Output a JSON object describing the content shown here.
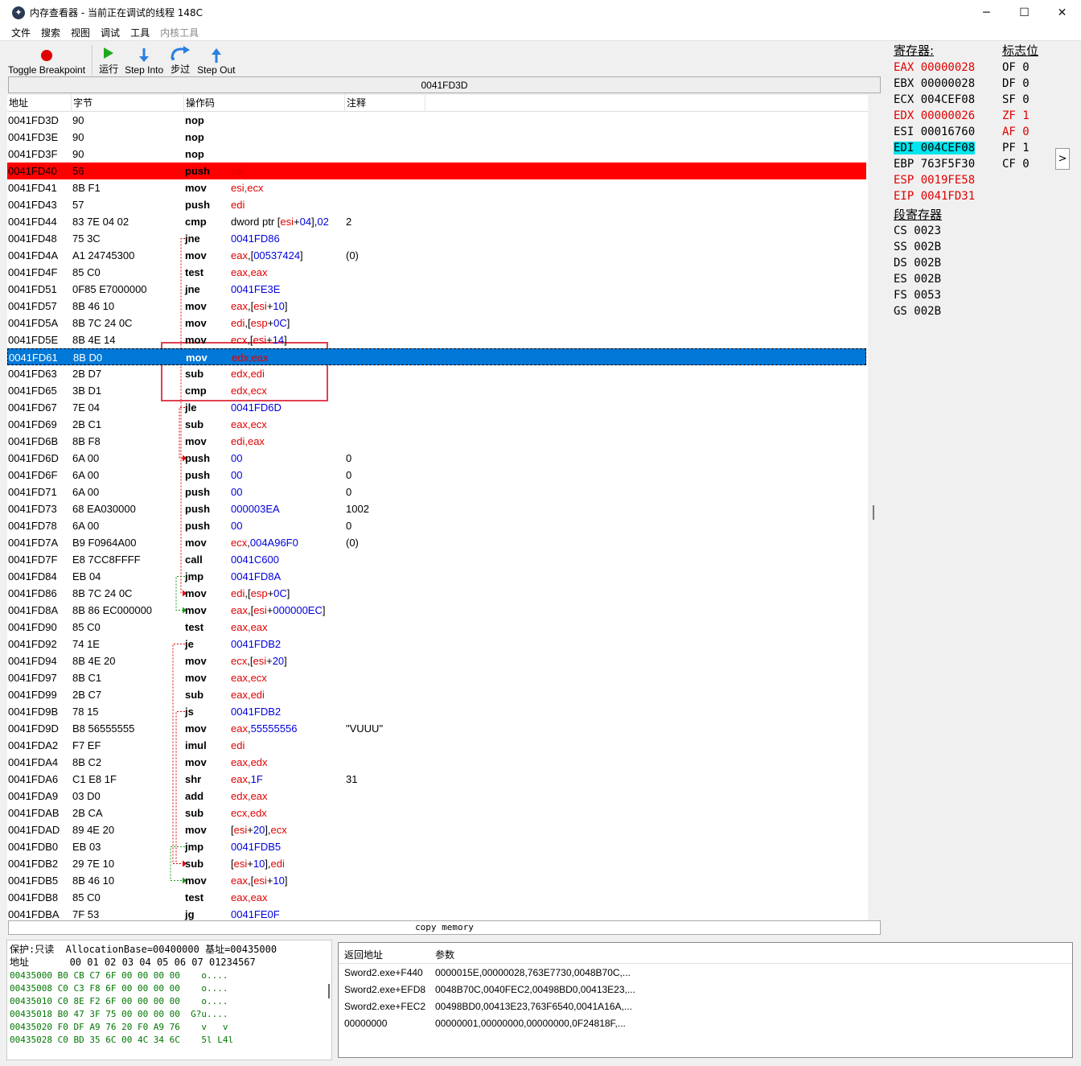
{
  "window": {
    "title": "内存查看器 - 当前正在调试的线程 148C",
    "minimize": "─",
    "maximize": "☐",
    "close": "✕"
  },
  "menu": [
    "文件",
    "搜索",
    "视图",
    "调试",
    "工具",
    "内核工具"
  ],
  "toolbar": {
    "toggle_breakpoint": "Toggle Breakpoint",
    "run": "运行",
    "step_into": "Step Into",
    "step_over": "步过",
    "step_out": "Step Out"
  },
  "address_bar": "0041FD3D",
  "columns": {
    "address": "地址",
    "bytes": "字节",
    "opcode": "操作码",
    "comment": "注释"
  },
  "rows": [
    {
      "addr": "0041FD3D",
      "bytes": "90",
      "op": "nop",
      "args": [],
      "cmt": ""
    },
    {
      "addr": "0041FD3E",
      "bytes": "90",
      "op": "nop",
      "args": [],
      "cmt": ""
    },
    {
      "addr": "0041FD3F",
      "bytes": "90",
      "op": "nop",
      "args": [],
      "cmt": ""
    },
    {
      "addr": "0041FD40",
      "bytes": "56",
      "op": "push",
      "args": [
        {
          "t": "esi",
          "c": "reg"
        }
      ],
      "cmt": "",
      "state": "bp"
    },
    {
      "addr": "0041FD41",
      "bytes": "8B F1",
      "op": "mov",
      "args": [
        {
          "t": "esi,ecx",
          "c": "reg"
        }
      ],
      "cmt": ""
    },
    {
      "addr": "0041FD43",
      "bytes": "57",
      "op": "push",
      "args": [
        {
          "t": "edi",
          "c": "reg"
        }
      ],
      "cmt": ""
    },
    {
      "addr": "0041FD44",
      "bytes": "83 7E 04 02",
      "op": "cmp",
      "args": [
        {
          "t": "dword ptr [",
          "c": "blk"
        },
        {
          "t": "esi",
          "c": "reg"
        },
        {
          "t": "+",
          "c": "blk"
        },
        {
          "t": "04",
          "c": "num"
        },
        {
          "t": "],",
          "c": "blk"
        },
        {
          "t": "02",
          "c": "num"
        }
      ],
      "cmt": "2"
    },
    {
      "addr": "0041FD48",
      "bytes": "75 3C",
      "op": "jne",
      "args": [
        {
          "t": "0041FD86",
          "c": "num"
        }
      ],
      "cmt": ""
    },
    {
      "addr": "0041FD4A",
      "bytes": "A1 24745300",
      "op": "mov",
      "args": [
        {
          "t": "eax",
          "c": "reg"
        },
        {
          "t": ",[",
          "c": "blk"
        },
        {
          "t": "00537424",
          "c": "num"
        },
        {
          "t": "]",
          "c": "blk"
        }
      ],
      "cmt": "(0)"
    },
    {
      "addr": "0041FD4F",
      "bytes": "85 C0",
      "op": "test",
      "args": [
        {
          "t": "eax,eax",
          "c": "reg"
        }
      ],
      "cmt": ""
    },
    {
      "addr": "0041FD51",
      "bytes": "0F85 E7000000",
      "op": "jne",
      "args": [
        {
          "t": "0041FE3E",
          "c": "num"
        }
      ],
      "cmt": ""
    },
    {
      "addr": "0041FD57",
      "bytes": "8B 46 10",
      "op": "mov",
      "args": [
        {
          "t": "eax",
          "c": "reg"
        },
        {
          "t": ",[",
          "c": "blk"
        },
        {
          "t": "esi",
          "c": "reg"
        },
        {
          "t": "+",
          "c": "blk"
        },
        {
          "t": "10",
          "c": "num"
        },
        {
          "t": "]",
          "c": "blk"
        }
      ],
      "cmt": ""
    },
    {
      "addr": "0041FD5A",
      "bytes": "8B 7C 24 0C",
      "op": "mov",
      "args": [
        {
          "t": "edi",
          "c": "reg"
        },
        {
          "t": ",[",
          "c": "blk"
        },
        {
          "t": "esp",
          "c": "reg"
        },
        {
          "t": "+",
          "c": "blk"
        },
        {
          "t": "0C",
          "c": "num"
        },
        {
          "t": "]",
          "c": "blk"
        }
      ],
      "cmt": ""
    },
    {
      "addr": "0041FD5E",
      "bytes": "8B 4E 14",
      "op": "mov",
      "args": [
        {
          "t": "ecx",
          "c": "reg"
        },
        {
          "t": ",[",
          "c": "blk"
        },
        {
          "t": "esi",
          "c": "reg"
        },
        {
          "t": "+",
          "c": "blk"
        },
        {
          "t": "14",
          "c": "num"
        },
        {
          "t": "]",
          "c": "blk"
        }
      ],
      "cmt": ""
    },
    {
      "addr": "0041FD61",
      "bytes": "8B D0",
      "op": "mov",
      "args": [
        {
          "t": "edx,eax",
          "c": "reg"
        }
      ],
      "cmt": "",
      "state": "cur"
    },
    {
      "addr": "0041FD63",
      "bytes": "2B D7",
      "op": "sub",
      "args": [
        {
          "t": "edx,edi",
          "c": "reg"
        }
      ],
      "cmt": ""
    },
    {
      "addr": "0041FD65",
      "bytes": "3B D1",
      "op": "cmp",
      "args": [
        {
          "t": "edx,ecx",
          "c": "reg"
        }
      ],
      "cmt": ""
    },
    {
      "addr": "0041FD67",
      "bytes": "7E 04",
      "op": "jle",
      "args": [
        {
          "t": "0041FD6D",
          "c": "num"
        }
      ],
      "cmt": ""
    },
    {
      "addr": "0041FD69",
      "bytes": "2B C1",
      "op": "sub",
      "args": [
        {
          "t": "eax,ecx",
          "c": "reg"
        }
      ],
      "cmt": ""
    },
    {
      "addr": "0041FD6B",
      "bytes": "8B F8",
      "op": "mov",
      "args": [
        {
          "t": "edi,eax",
          "c": "reg"
        }
      ],
      "cmt": ""
    },
    {
      "addr": "0041FD6D",
      "bytes": "6A 00",
      "op": "push",
      "args": [
        {
          "t": "00",
          "c": "num"
        }
      ],
      "cmt": "0"
    },
    {
      "addr": "0041FD6F",
      "bytes": "6A 00",
      "op": "push",
      "args": [
        {
          "t": "00",
          "c": "num"
        }
      ],
      "cmt": "0"
    },
    {
      "addr": "0041FD71",
      "bytes": "6A 00",
      "op": "push",
      "args": [
        {
          "t": "00",
          "c": "num"
        }
      ],
      "cmt": "0"
    },
    {
      "addr": "0041FD73",
      "bytes": "68 EA030000",
      "op": "push",
      "args": [
        {
          "t": "000003EA",
          "c": "num"
        }
      ],
      "cmt": "1002"
    },
    {
      "addr": "0041FD78",
      "bytes": "6A 00",
      "op": "push",
      "args": [
        {
          "t": "00",
          "c": "num"
        }
      ],
      "cmt": "0"
    },
    {
      "addr": "0041FD7A",
      "bytes": "B9 F0964A00",
      "op": "mov",
      "args": [
        {
          "t": "ecx",
          "c": "reg"
        },
        {
          "t": ",",
          "c": "blk"
        },
        {
          "t": "004A96F0",
          "c": "num"
        }
      ],
      "cmt": "(0)"
    },
    {
      "addr": "0041FD7F",
      "bytes": "E8 7CC8FFFF",
      "op": "call",
      "args": [
        {
          "t": "0041C600",
          "c": "num"
        }
      ],
      "cmt": ""
    },
    {
      "addr": "0041FD84",
      "bytes": "EB 04",
      "op": "jmp",
      "args": [
        {
          "t": "0041FD8A",
          "c": "num"
        }
      ],
      "cmt": ""
    },
    {
      "addr": "0041FD86",
      "bytes": "8B 7C 24 0C",
      "op": "mov",
      "args": [
        {
          "t": "edi",
          "c": "reg"
        },
        {
          "t": ",[",
          "c": "blk"
        },
        {
          "t": "esp",
          "c": "reg"
        },
        {
          "t": "+",
          "c": "blk"
        },
        {
          "t": "0C",
          "c": "num"
        },
        {
          "t": "]",
          "c": "blk"
        }
      ],
      "cmt": ""
    },
    {
      "addr": "0041FD8A",
      "bytes": "8B 86 EC000000",
      "op": "mov",
      "args": [
        {
          "t": "eax",
          "c": "reg"
        },
        {
          "t": ",[",
          "c": "blk"
        },
        {
          "t": "esi",
          "c": "reg"
        },
        {
          "t": "+",
          "c": "blk"
        },
        {
          "t": "000000EC",
          "c": "num"
        },
        {
          "t": "]",
          "c": "blk"
        }
      ],
      "cmt": ""
    },
    {
      "addr": "0041FD90",
      "bytes": "85 C0",
      "op": "test",
      "args": [
        {
          "t": "eax,eax",
          "c": "reg"
        }
      ],
      "cmt": ""
    },
    {
      "addr": "0041FD92",
      "bytes": "74 1E",
      "op": "je",
      "args": [
        {
          "t": "0041FDB2",
          "c": "num"
        }
      ],
      "cmt": ""
    },
    {
      "addr": "0041FD94",
      "bytes": "8B 4E 20",
      "op": "mov",
      "args": [
        {
          "t": "ecx",
          "c": "reg"
        },
        {
          "t": ",[",
          "c": "blk"
        },
        {
          "t": "esi",
          "c": "reg"
        },
        {
          "t": "+",
          "c": "blk"
        },
        {
          "t": "20",
          "c": "num"
        },
        {
          "t": "]",
          "c": "blk"
        }
      ],
      "cmt": ""
    },
    {
      "addr": "0041FD97",
      "bytes": "8B C1",
      "op": "mov",
      "args": [
        {
          "t": "eax,ecx",
          "c": "reg"
        }
      ],
      "cmt": ""
    },
    {
      "addr": "0041FD99",
      "bytes": "2B C7",
      "op": "sub",
      "args": [
        {
          "t": "eax,edi",
          "c": "reg"
        }
      ],
      "cmt": ""
    },
    {
      "addr": "0041FD9B",
      "bytes": "78 15",
      "op": "js",
      "args": [
        {
          "t": "0041FDB2",
          "c": "num"
        }
      ],
      "cmt": ""
    },
    {
      "addr": "0041FD9D",
      "bytes": "B8 56555555",
      "op": "mov",
      "args": [
        {
          "t": "eax",
          "c": "reg"
        },
        {
          "t": ",",
          "c": "blk"
        },
        {
          "t": "55555556",
          "c": "num"
        }
      ],
      "cmt": "\"VUUU\""
    },
    {
      "addr": "0041FDA2",
      "bytes": "F7 EF",
      "op": "imul",
      "args": [
        {
          "t": "edi",
          "c": "reg"
        }
      ],
      "cmt": ""
    },
    {
      "addr": "0041FDA4",
      "bytes": "8B C2",
      "op": "mov",
      "args": [
        {
          "t": "eax,edx",
          "c": "reg"
        }
      ],
      "cmt": ""
    },
    {
      "addr": "0041FDA6",
      "bytes": "C1 E8 1F",
      "op": "shr",
      "args": [
        {
          "t": "eax",
          "c": "reg"
        },
        {
          "t": ",",
          "c": "blk"
        },
        {
          "t": "1F",
          "c": "num"
        }
      ],
      "cmt": "31"
    },
    {
      "addr": "0041FDA9",
      "bytes": "03 D0",
      "op": "add",
      "args": [
        {
          "t": "edx,eax",
          "c": "reg"
        }
      ],
      "cmt": ""
    },
    {
      "addr": "0041FDAB",
      "bytes": "2B CA",
      "op": "sub",
      "args": [
        {
          "t": "ecx,edx",
          "c": "reg"
        }
      ],
      "cmt": ""
    },
    {
      "addr": "0041FDAD",
      "bytes": "89 4E 20",
      "op": "mov",
      "args": [
        {
          "t": "[",
          "c": "blk"
        },
        {
          "t": "esi",
          "c": "reg"
        },
        {
          "t": "+",
          "c": "blk"
        },
        {
          "t": "20",
          "c": "num"
        },
        {
          "t": "],",
          "c": "blk"
        },
        {
          "t": "ecx",
          "c": "reg"
        }
      ],
      "cmt": ""
    },
    {
      "addr": "0041FDB0",
      "bytes": "EB 03",
      "op": "jmp",
      "args": [
        {
          "t": "0041FDB5",
          "c": "num"
        }
      ],
      "cmt": ""
    },
    {
      "addr": "0041FDB2",
      "bytes": "29 7E 10",
      "op": "sub",
      "args": [
        {
          "t": "[",
          "c": "blk"
        },
        {
          "t": "esi",
          "c": "reg"
        },
        {
          "t": "+",
          "c": "blk"
        },
        {
          "t": "10",
          "c": "num"
        },
        {
          "t": "],",
          "c": "blk"
        },
        {
          "t": "edi",
          "c": "reg"
        }
      ],
      "cmt": ""
    },
    {
      "addr": "0041FDB5",
      "bytes": "8B 46 10",
      "op": "mov",
      "args": [
        {
          "t": "eax",
          "c": "reg"
        },
        {
          "t": ",[",
          "c": "blk"
        },
        {
          "t": "esi",
          "c": "reg"
        },
        {
          "t": "+",
          "c": "blk"
        },
        {
          "t": "10",
          "c": "num"
        },
        {
          "t": "]",
          "c": "blk"
        }
      ],
      "cmt": ""
    },
    {
      "addr": "0041FDB8",
      "bytes": "85 C0",
      "op": "test",
      "args": [
        {
          "t": "eax,eax",
          "c": "reg"
        }
      ],
      "cmt": ""
    },
    {
      "addr": "0041FDBA",
      "bytes": "7F 53",
      "op": "jg",
      "args": [
        {
          "t": "0041FE0F",
          "c": "num"
        }
      ],
      "cmt": ""
    }
  ],
  "copy_memory": "copy memory",
  "registers": {
    "title": "寄存器:",
    "flags_title": "标志位",
    "segments_title": "段寄存器",
    "general": [
      {
        "name": "EAX",
        "value": "00000028",
        "changed": true
      },
      {
        "name": "EBX",
        "value": "00000028",
        "changed": false
      },
      {
        "name": "ECX",
        "value": "004CEF08",
        "changed": false
      },
      {
        "name": "EDX",
        "value": "00000026",
        "changed": true
      },
      {
        "name": "ESI",
        "value": "00016760",
        "changed": false
      },
      {
        "name": "EDI",
        "value": "004CEF08",
        "changed": false,
        "highlight": true
      },
      {
        "name": "EBP",
        "value": "763F5F30",
        "changed": false
      },
      {
        "name": "ESP",
        "value": "0019FE58",
        "changed": true
      },
      {
        "name": "EIP",
        "value": "0041FD31",
        "changed": true
      }
    ],
    "flags": [
      {
        "name": "OF",
        "value": "0",
        "changed": false
      },
      {
        "name": "DF",
        "value": "0",
        "changed": false
      },
      {
        "name": "SF",
        "value": "0",
        "changed": false
      },
      {
        "name": "ZF",
        "value": "1",
        "changed": true
      },
      {
        "name": "AF",
        "value": "0",
        "changed": true
      },
      {
        "name": "PF",
        "value": "1",
        "changed": false
      },
      {
        "name": "CF",
        "value": "0",
        "changed": false
      }
    ],
    "segments": [
      {
        "name": "CS",
        "value": "0023"
      },
      {
        "name": "SS",
        "value": "002B"
      },
      {
        "name": "DS",
        "value": "002B"
      },
      {
        "name": "ES",
        "value": "002B"
      },
      {
        "name": "FS",
        "value": "0053"
      },
      {
        "name": "GS",
        "value": "002B"
      }
    ],
    "expand_button": ">"
  },
  "hex": {
    "header1": "保护:只读  AllocationBase=00400000 基址=00435000",
    "header2": "地址       00 01 02 03 04 05 06 07 01234567",
    "rows": [
      "00435000 B0 CB C7 6F 00 00 00 00    o....",
      "00435008 C0 C3 F8 6F 00 00 00 00    o....",
      "00435010 C0 8E F2 6F 00 00 00 00    o....",
      "00435018 B0 47 3F 75 00 00 00 00  G?u....",
      "00435020 F0 DF A9 76 20 F0 A9 76    v   v",
      "00435028 C0 BD 35 6C 00 4C 34 6C    5l L4l"
    ]
  },
  "stack": {
    "col_return": "返回地址",
    "col_params": "参数",
    "rows": [
      {
        "ret": "Sword2.exe+F440",
        "params": "0000015E,00000028,763E7730,0048B70C,..."
      },
      {
        "ret": "Sword2.exe+EFD8",
        "params": "0048B70C,0040FEC2,00498BD0,00413E23,..."
      },
      {
        "ret": "Sword2.exe+FEC2",
        "params": "00498BD0,00413E23,763F6540,0041A16A,..."
      },
      {
        "ret": "00000000",
        "params": "00000001,00000000,00000000,0F24818F,..."
      }
    ]
  },
  "colors": {
    "breakpoint": "#ff0000",
    "current": "#0078d7",
    "register": "#e00000",
    "number": "#0000dd",
    "highlight": "#00e5ee"
  }
}
